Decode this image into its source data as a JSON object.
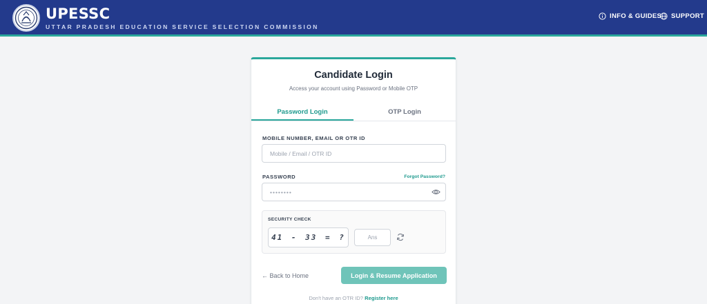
{
  "header": {
    "title": "UPESSC",
    "subtitle": "UTTAR PRADESH EDUCATION SERVICE SELECTION COMMISSION",
    "nav": {
      "info": "INFO & GUIDES",
      "support": "SUPPORT"
    }
  },
  "login": {
    "title": "Candidate Login",
    "subtitle": "Access your account using Password or Mobile OTP",
    "tabs": [
      {
        "label": "Password Login",
        "active": true
      },
      {
        "label": "OTP Login",
        "active": false
      }
    ],
    "id_field": {
      "label": "MOBILE NUMBER, EMAIL OR OTR ID",
      "placeholder": "Mobile / Email / OTR ID"
    },
    "password_field": {
      "label": "PASSWORD",
      "forgot": "Forgot Password?",
      "placeholder": "••••••••"
    },
    "security": {
      "label": "SECURITY CHECK",
      "captcha": "41 - 33 = ?",
      "answer_placeholder": "Ans"
    },
    "back": "← Back to Home",
    "submit": "Login & Resume Application",
    "register_prompt": "Don't have an OTR ID?",
    "register_link": "Register here"
  },
  "colors": {
    "header_bg": "#233a8c",
    "accent": "#2aa79b",
    "button": "#6fc4b9"
  }
}
